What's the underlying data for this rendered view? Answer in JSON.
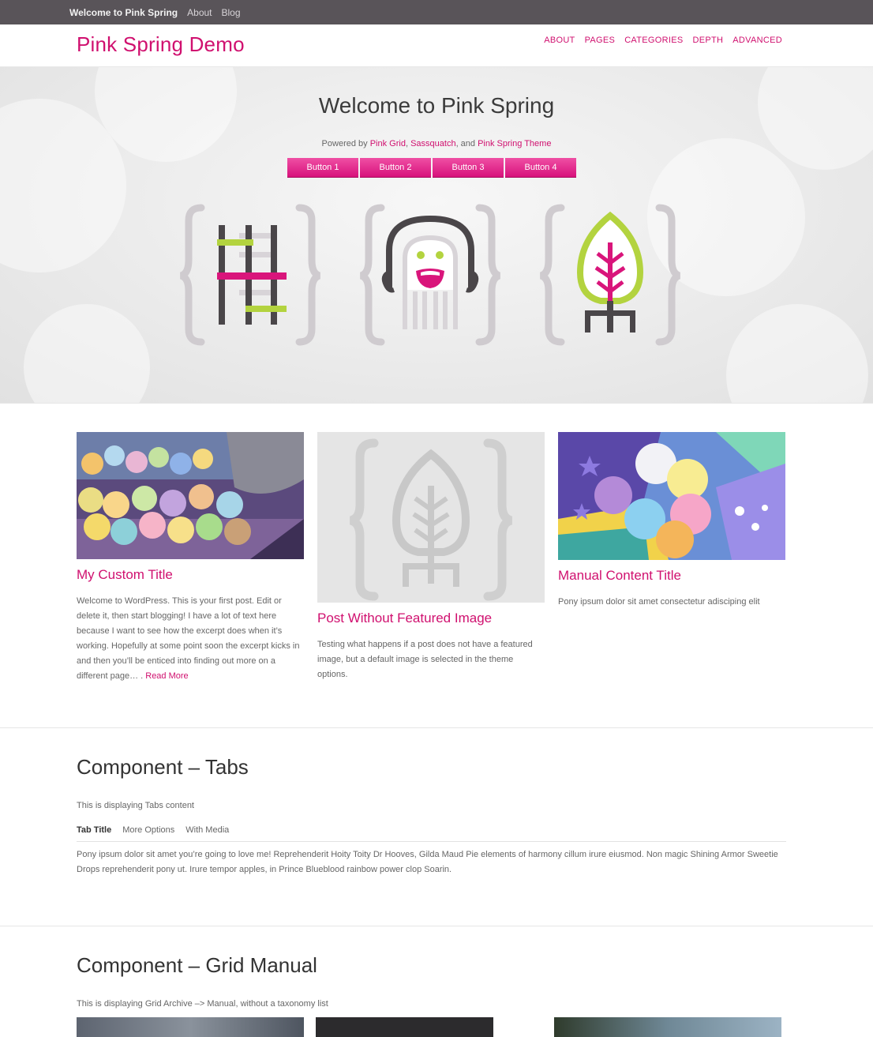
{
  "adminbar": {
    "site": "Welcome to Pink Spring",
    "items": [
      "About",
      "Blog"
    ]
  },
  "header": {
    "site_title": "Pink Spring Demo",
    "nav": [
      "ABOUT",
      "PAGES",
      "CATEGORIES",
      "DEPTH",
      "ADVANCED"
    ]
  },
  "hero": {
    "title": "Welcome to Pink Spring",
    "powered_prefix": "Powered by ",
    "link1": "Pink Grid",
    "sep1": ", ",
    "link2": "Sassquatch",
    "sep2": ", and ",
    "link3": "Pink Spring Theme",
    "buttons": [
      "Button 1",
      "Button 2",
      "Button 3",
      "Button 4"
    ]
  },
  "posts": [
    {
      "title": "My Custom Title",
      "excerpt": "Welcome to WordPress. This is your first post. Edit or delete it, then start blogging! I have a lot of text here because I want to see how the excerpt does when it’s working. Hopefully at some point soon the excerpt kicks in and then you’ll be enticed into finding out more on a different page… .",
      "read_more": "Read More"
    },
    {
      "title": "Post Without Featured Image",
      "excerpt": "Testing what happens if a post does not have a featured image, but a default image is selected in the theme options."
    },
    {
      "title": "Manual Content Title",
      "excerpt": "Pony ipsum dolor sit amet consectetur adisciping elit"
    }
  ],
  "tabs_section": {
    "title": "Component – Tabs",
    "desc": "This is displaying Tabs content",
    "tabs": [
      "Tab Title",
      "More Options",
      "With Media"
    ],
    "content": "Pony ipsum dolor sit amet you’re going to love me! Reprehenderit Hoity Toity Dr Hooves, Gilda Maud Pie elements of harmony cillum irure eiusmod. Non magic Shining Armor Sweetie Drops reprehenderit pony ut. Irure tempor apples, in Prince Blueblood rainbow power clop Soarin."
  },
  "grid_section": {
    "title": "Component – Grid Manual",
    "desc": "This is displaying Grid Archive –> Manual, without a taxonomy list"
  },
  "colors": {
    "accent": "#d0106f",
    "adminbar": "#595459",
    "green": "#b3d33f",
    "dark": "#4a4649"
  }
}
